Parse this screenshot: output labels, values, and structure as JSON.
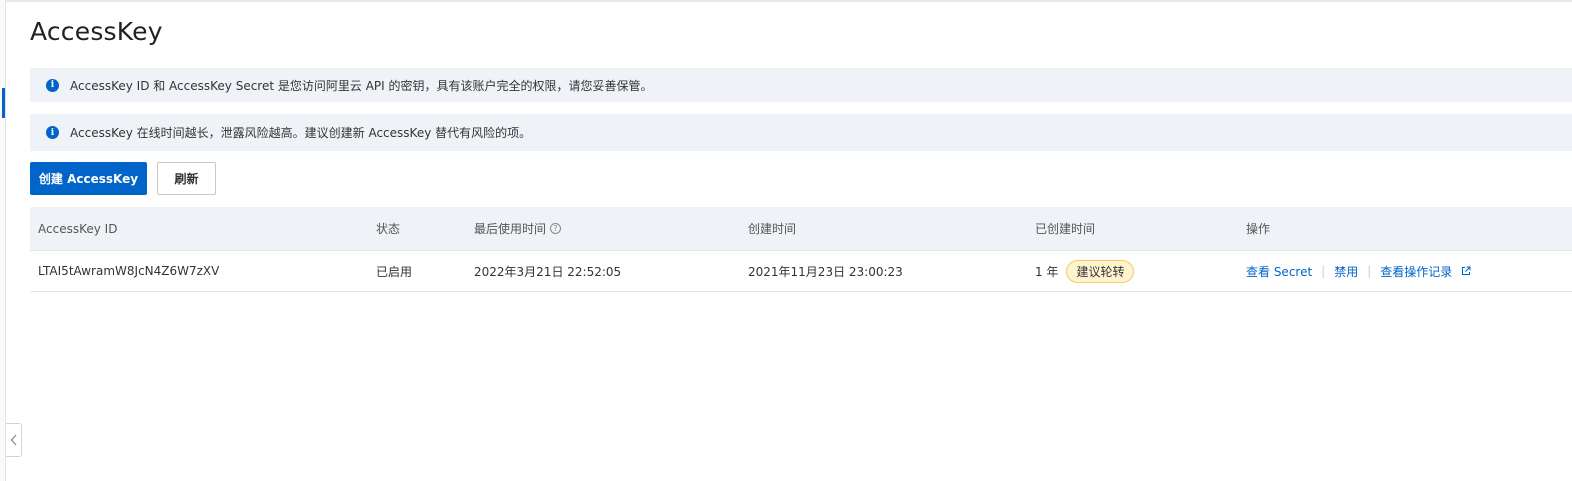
{
  "page": {
    "title": "AccessKey"
  },
  "notices": [
    {
      "icon": "info-icon",
      "text": "AccessKey ID 和 AccessKey Secret 是您访问阿里云 API 的密钥，具有该账户完全的权限，请您妥善保管。"
    },
    {
      "icon": "info-icon",
      "text": "AccessKey 在线时间越长，泄露风险越高。建议创建新 AccessKey 替代有风险的项。"
    }
  ],
  "toolbar": {
    "create_label": "创建 AccessKey",
    "refresh_label": "刷新"
  },
  "table": {
    "columns": [
      "AccessKey ID",
      "状态",
      "最后使用时间",
      "创建时间",
      "已创建时间",
      "操作"
    ],
    "rows": [
      {
        "id": "LTAI5tAwramW8JcN4Z6W7zXV",
        "status": "已启用",
        "last_used": "2022年3月21日 22:52:05",
        "created": "2021年11月23日 23:00:23",
        "age": "1 年",
        "age_tag": "建议轮转",
        "actions": {
          "view_secret": "查看 Secret",
          "disable": "禁用",
          "view_log": "查看操作记录"
        }
      }
    ]
  },
  "colors": {
    "primary": "#0064c8",
    "notice_bg": "#eff3f8",
    "tag_bg": "#fff4cf",
    "tag_border": "#f2cf5b"
  }
}
